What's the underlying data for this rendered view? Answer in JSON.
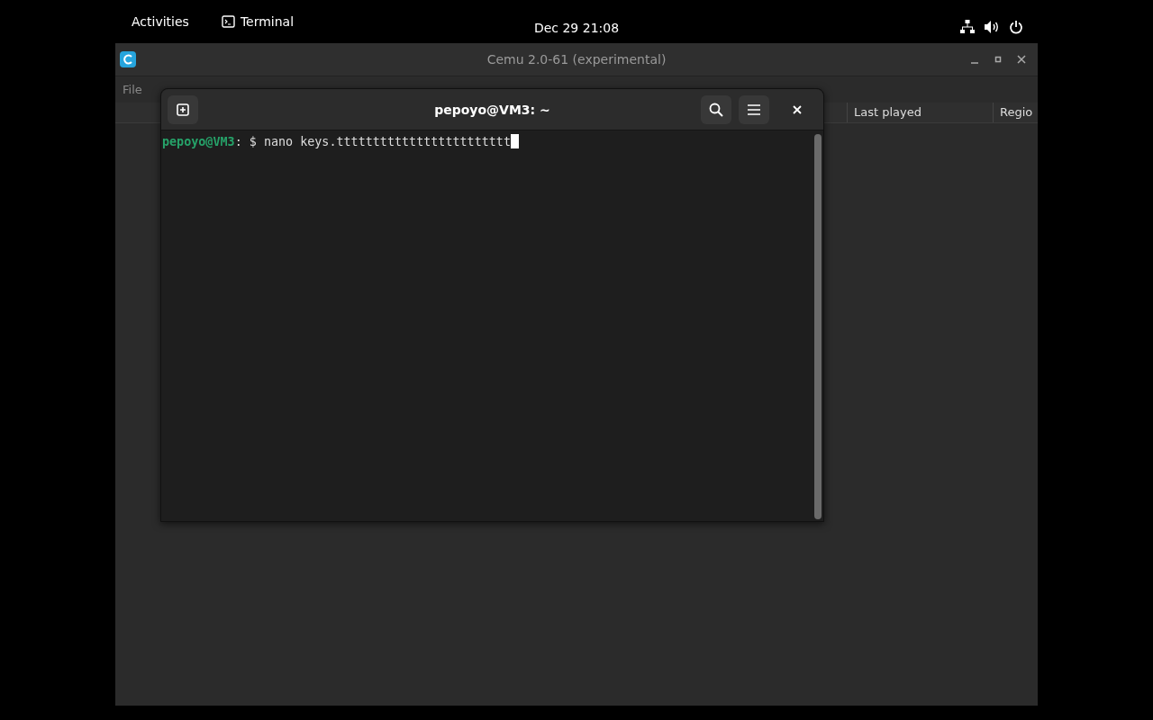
{
  "top_bar": {
    "activities": "Activities",
    "app_name": "Terminal",
    "clock": "Dec 29  21:08"
  },
  "cemu_window": {
    "title": "Cemu 2.0-61 (experimental)",
    "menu": [
      "File"
    ],
    "columns": [
      "Last played",
      "Regio"
    ]
  },
  "terminal": {
    "title": "pepoyo@VM3: ~",
    "prompt_user": "pepoyo@VM3",
    "prompt_rest": ": $ ",
    "command": "nano keys.tttttttttttttttttttttttt"
  }
}
